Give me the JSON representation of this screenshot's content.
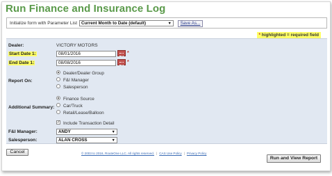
{
  "title": "Run Finance and Insurance Log",
  "param_bar": {
    "label": "Initialize form with Parameter List",
    "selected": "Current Month to Date (default)",
    "save_as": "Save As..."
  },
  "required_note": {
    "star": "*",
    "text": "highlighted = required field"
  },
  "form": {
    "dealer_label": "Dealer:",
    "dealer_value": "VICTORY MOTORS",
    "start_label": "Start Date 1:",
    "start_value": "08/01/2016",
    "end_label": "End Date 1:",
    "end_value": "08/08/2016",
    "required_mark": "*",
    "report_on_label": "Report On:",
    "report_on_options": [
      "Dealer/Dealer Group",
      "F&I Manager",
      "Salesperson"
    ],
    "report_on_selected": 0,
    "summary_label": "Additional Summary:",
    "summary_options": [
      "Finance Source",
      "Car/Truck",
      "Retail/Lease/Balloon"
    ],
    "summary_selected": 0,
    "include_detail_label": "Include Transaction Detail",
    "include_detail_checked": true,
    "fi_manager_label": "F&I Manager:",
    "fi_manager_value": "ANDY",
    "salesperson_label": "Salesperson:",
    "salesperson_value": "ALAN CROSS"
  },
  "buttons": {
    "cancel": "Cancel",
    "run": "Run and View Report"
  },
  "footer": {
    "copyright": "© 2003 to 2016, RouteOne LLC. All rights reserved.",
    "terms": "CAS Use Policy",
    "privacy": "Privacy Policy"
  }
}
